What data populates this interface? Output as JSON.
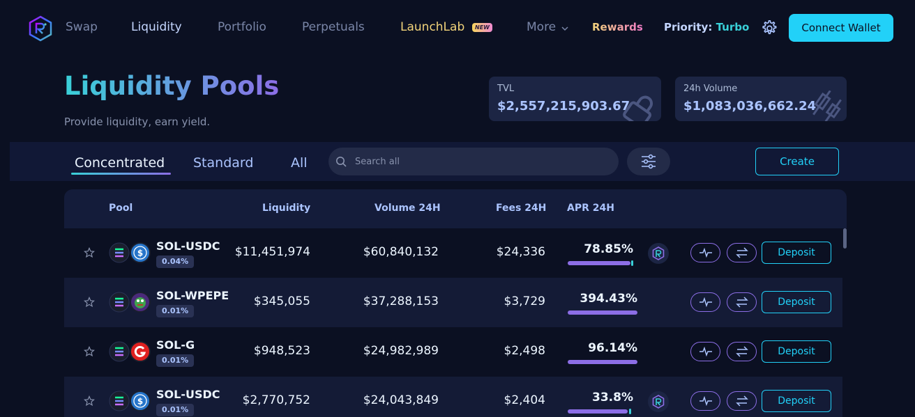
{
  "nav": {
    "links": [
      "Swap",
      "Liquidity",
      "Portfolio",
      "Perpetuals",
      "LaunchLab",
      "More"
    ],
    "new_badge": "NEW",
    "rewards": "Rewards",
    "priority_label": "Priority:",
    "priority_value": "Turbo",
    "connect": "Connect Wallet"
  },
  "header": {
    "title": "Liquidity Pools",
    "subtitle": "Provide liquidity, earn yield."
  },
  "stats": {
    "tvl_label": "TVL",
    "tvl_value": "$2,557,215,903.67",
    "volume_label": "24h Volume",
    "volume_value": "$1,083,036,662.24"
  },
  "tabs": [
    "Concentrated",
    "Standard",
    "All"
  ],
  "search": {
    "placeholder": "Search all"
  },
  "create": "Create",
  "table": {
    "headers": [
      "Pool",
      "Liquidity",
      "Volume 24H",
      "Fees 24H",
      "APR 24H"
    ],
    "rows": [
      {
        "pair": "SOL-USDC",
        "fee": "0.04%",
        "liquidity": "$11,451,974",
        "volume": "$60,840,132",
        "fees": "$24,336",
        "apr": "78.85%",
        "deposit": "Deposit"
      },
      {
        "pair": "SOL-WPEPE",
        "fee": "0.01%",
        "liquidity": "$345,055",
        "volume": "$37,288,153",
        "fees": "$3,729",
        "apr": "394.43%",
        "deposit": "Deposit"
      },
      {
        "pair": "SOL-G",
        "fee": "0.01%",
        "liquidity": "$948,523",
        "volume": "$24,982,989",
        "fees": "$2,498",
        "apr": "96.14%",
        "deposit": "Deposit"
      },
      {
        "pair": "SOL-USDC",
        "fee": "0.01%",
        "liquidity": "$2,770,752",
        "volume": "$24,043,849",
        "fees": "$2,404",
        "apr": "33.8%",
        "deposit": "Deposit"
      }
    ]
  },
  "colors": {
    "accent": "#22d1f8",
    "purple": "#8c6ee6",
    "teal": "#39d0d8",
    "bg": "#0b1022"
  }
}
